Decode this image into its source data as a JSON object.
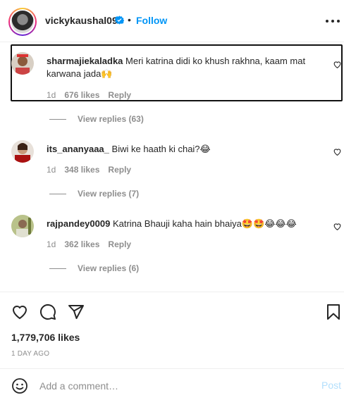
{
  "header": {
    "username": "vickykaushal09",
    "separator": "•",
    "follow_label": "Follow"
  },
  "comments": [
    {
      "username": "sharmajiekaladka",
      "text_line1": "Meri katrina didi ko khush rakhna, kaam mat",
      "text_line2": "karwana jada",
      "emojis": "🙌",
      "time": "1d",
      "likes": "676 likes",
      "reply_label": "Reply",
      "view_replies": "View replies (63)",
      "highlighted": true
    },
    {
      "username": "its_ananyaaa_",
      "text_line1": "Biwi ke haath ki chai?",
      "emojis": "😂",
      "time": "1d",
      "likes": "348 likes",
      "reply_label": "Reply",
      "view_replies": "View replies (7)"
    },
    {
      "username": "rajpandey0009",
      "text_line1": "Katrina Bhauji kaha hain bhaiya",
      "emojis": "🤩🤩😂😂😂",
      "time": "1d",
      "likes": "362 likes",
      "reply_label": "Reply",
      "view_replies": "View replies (6)"
    }
  ],
  "post": {
    "likes": "1,779,706 likes",
    "time_ago": "1 DAY AGO"
  },
  "add_comment": {
    "placeholder": "Add a comment…",
    "post_label": "Post"
  },
  "colors": {
    "accent": "#0095f6",
    "muted": "#8e8e8e",
    "post_disabled": "#b2dffc"
  },
  "icons": [
    "verified-badge-icon",
    "more-options-icon",
    "heart-icon",
    "comment-icon",
    "share-icon",
    "bookmark-icon",
    "emoji-icon"
  ]
}
